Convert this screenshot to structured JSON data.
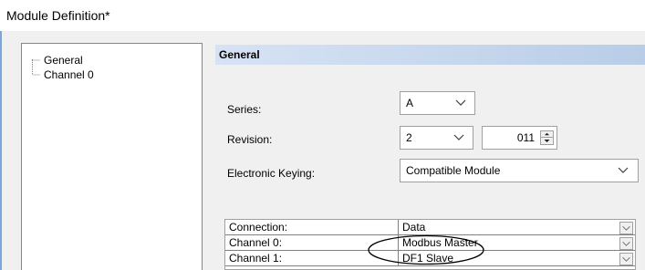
{
  "window": {
    "title": "Module Definition*"
  },
  "tree": {
    "items": [
      {
        "label": "General",
        "selected": true
      },
      {
        "label": "Channel 0",
        "selected": false
      }
    ]
  },
  "section": {
    "title": "General"
  },
  "form": {
    "series": {
      "label": "Series:",
      "value": "A"
    },
    "revision": {
      "label": "Revision:",
      "major": "2",
      "minor": "011"
    },
    "keying": {
      "label": "Electronic Keying:",
      "value": "Compatible Module"
    }
  },
  "grid": {
    "rows": [
      {
        "name": "Connection:",
        "value": "Data"
      },
      {
        "name": "Channel 0:",
        "value": "Modbus Master"
      },
      {
        "name": "Channel 1:",
        "value": "DF1 Slave"
      }
    ]
  },
  "icons": {
    "dropdown": "chevron-down-icon",
    "spinner": "spinner-arrows-icon"
  },
  "colors": {
    "header_gradient_start": "#d7e3f4",
    "header_gradient_end": "#b9cde8",
    "accent": "#7ba7d8"
  }
}
